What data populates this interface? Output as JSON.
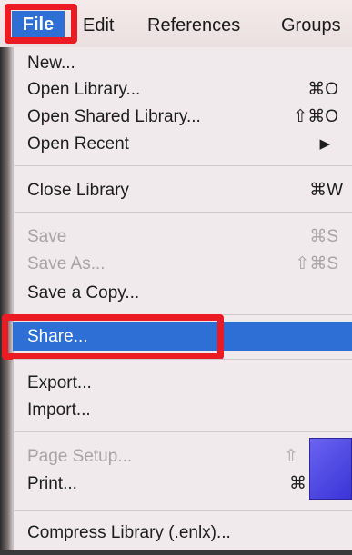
{
  "menubar": {
    "items": [
      "File",
      "Edit",
      "References",
      "Groups"
    ]
  },
  "menu": {
    "new": "New...",
    "open_library": "Open Library...",
    "open_library_sc": "⌘O",
    "open_shared": "Open Shared Library...",
    "open_shared_sc": "⇧⌘O",
    "open_recent": "Open Recent",
    "open_recent_sc": "▶",
    "close_library": "Close Library",
    "close_library_sc": "⌘W",
    "save": "Save",
    "save_sc": "⌘S",
    "save_as": "Save As...",
    "save_as_sc": "⇧⌘S",
    "save_copy": "Save a Copy...",
    "share": "Share...",
    "export": "Export...",
    "import": "Import...",
    "page_setup": "Page Setup...",
    "page_setup_sc": "⇧",
    "print": "Print...",
    "print_sc": "⌘",
    "compress": "Compress Library (.enlx)..."
  },
  "colors": {
    "highlight": "#2e6fd6",
    "annotation": "#ec1b23"
  }
}
